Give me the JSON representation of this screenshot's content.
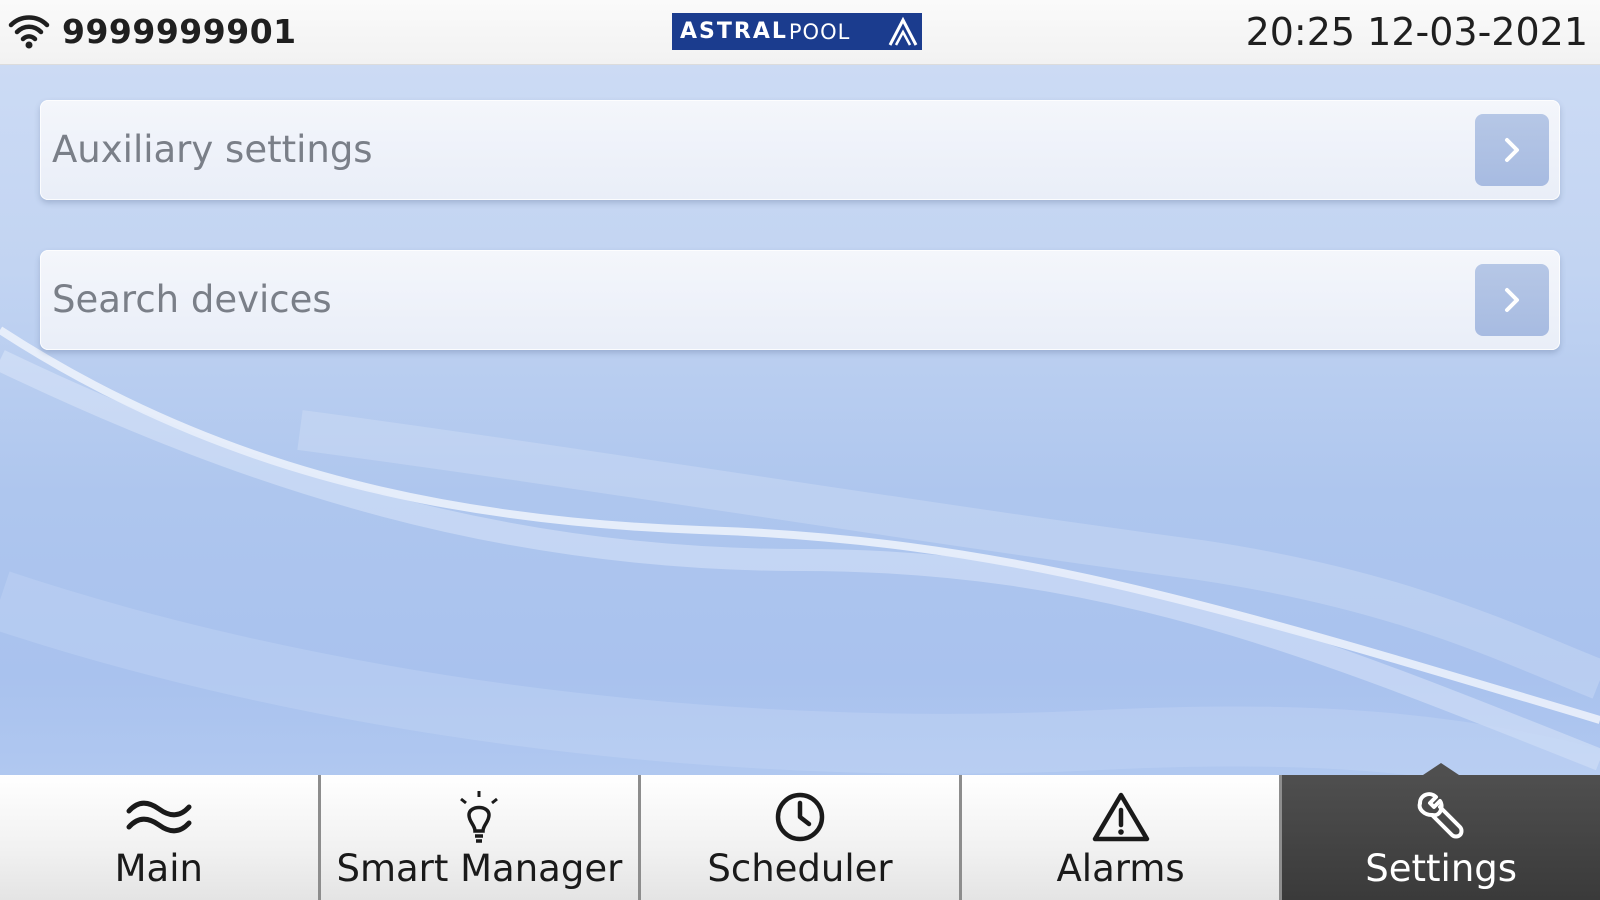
{
  "status_bar": {
    "device_id": "9999999901",
    "brand_part1": "ASTRAL",
    "brand_part2": "POOL",
    "datetime": "20:25 12-03-2021",
    "icons": [
      "wifi-icon",
      "brand-logo-mark-icon"
    ]
  },
  "menu": {
    "items": [
      {
        "label": "Auxiliary settings",
        "icon": "chevron-right-icon"
      },
      {
        "label": "Search devices",
        "icon": "chevron-right-icon"
      }
    ]
  },
  "nav": {
    "tabs": [
      {
        "label": "Main",
        "icon": "waves-icon",
        "active": false
      },
      {
        "label": "Smart Manager",
        "icon": "lightbulb-icon",
        "active": false
      },
      {
        "label": "Scheduler",
        "icon": "clock-icon",
        "active": false
      },
      {
        "label": "Alarms",
        "icon": "warning-icon",
        "active": false
      },
      {
        "label": "Settings",
        "icon": "wrench-icon",
        "active": true
      }
    ]
  },
  "colors": {
    "brand_blue": "#1b3c8e",
    "active_tab": "#3f3f3f",
    "background": "#b9cdf0",
    "arrow_button": "#a9bde2"
  }
}
